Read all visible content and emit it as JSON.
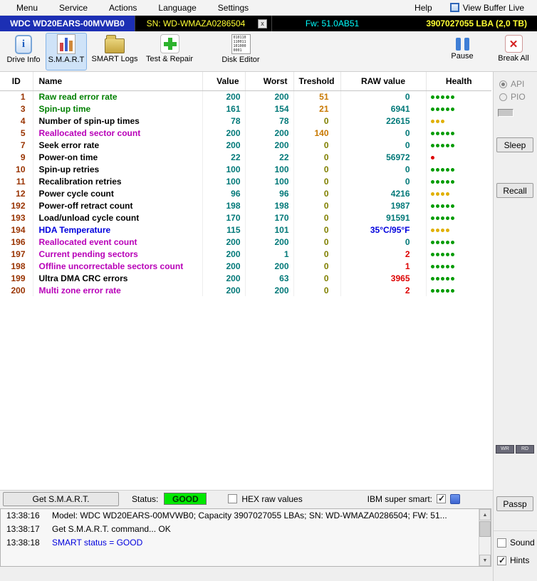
{
  "colors": {
    "green": "#008000",
    "magenta": "#b800b8",
    "blue": "#0000dd",
    "black": "#000000",
    "teal": "#007878",
    "orange": "#c87800",
    "olive": "#808000",
    "red": "#dd0000",
    "maroon": "#993300",
    "dot_green": "#009c00",
    "dot_yellow": "#e0b000",
    "dot_red": "#dd0000",
    "good_badge": "#00e800",
    "drive_tab_blue": "#1c2fb4",
    "title_yellow": "#ffff33",
    "title_cyan": "#00ffff"
  },
  "menubar": {
    "items": [
      {
        "label": "Menu"
      },
      {
        "label": "Service"
      },
      {
        "label": "Actions"
      },
      {
        "label": "Language"
      },
      {
        "label": "Settings"
      },
      {
        "label": "Help"
      }
    ],
    "view_buffer_label": "View Buffer Live"
  },
  "titlebar": {
    "model": "WDC WD20EARS-00MVWB0",
    "serial": "SN: WD-WMAZA0286504",
    "close_label": "x",
    "firmware": "Fw: 51.0AB51",
    "capacity": "3907027055 LBA (2,0 TB)"
  },
  "toolbar": {
    "buttons": [
      {
        "label": "Drive Info"
      },
      {
        "label": "S.M.A.R.T"
      },
      {
        "label": "SMART Logs"
      },
      {
        "label": "Test & Repair"
      },
      {
        "label": "Disk Editor"
      }
    ],
    "right_buttons": [
      {
        "label": "Pause"
      },
      {
        "label": "Break All"
      }
    ],
    "disk_editor_binary": "010110\n110011\n101000\n0001"
  },
  "table": {
    "headers": [
      "ID",
      "Name",
      "Value",
      "Worst",
      "Treshold",
      "RAW value",
      "Health"
    ],
    "rows": [
      {
        "id": "1",
        "name": "Raw read error rate",
        "name_color": "green",
        "value": "200",
        "worst": "200",
        "treshold": "51",
        "treshold_color": "orange",
        "raw": "0",
        "raw_color": "teal",
        "dots": 5,
        "dot_color": "dot_green"
      },
      {
        "id": "3",
        "name": "Spin-up time",
        "name_color": "green",
        "value": "161",
        "worst": "154",
        "treshold": "21",
        "treshold_color": "orange",
        "raw": "6941",
        "raw_color": "teal",
        "dots": 5,
        "dot_color": "dot_green"
      },
      {
        "id": "4",
        "name": "Number of spin-up times",
        "name_color": "black",
        "value": "78",
        "worst": "78",
        "treshold": "0",
        "treshold_color": "olive",
        "raw": "22615",
        "raw_color": "teal",
        "dots": 3,
        "dot_color": "dot_yellow"
      },
      {
        "id": "5",
        "name": "Reallocated sector count",
        "name_color": "magenta",
        "value": "200",
        "worst": "200",
        "treshold": "140",
        "treshold_color": "orange",
        "raw": "0",
        "raw_color": "teal",
        "dots": 5,
        "dot_color": "dot_green"
      },
      {
        "id": "7",
        "name": "Seek error rate",
        "name_color": "black",
        "value": "200",
        "worst": "200",
        "treshold": "0",
        "treshold_color": "olive",
        "raw": "0",
        "raw_color": "teal",
        "dots": 5,
        "dot_color": "dot_green"
      },
      {
        "id": "9",
        "name": "Power-on time",
        "name_color": "black",
        "value": "22",
        "worst": "22",
        "treshold": "0",
        "treshold_color": "olive",
        "raw": "56972",
        "raw_color": "teal",
        "dots": 1,
        "dot_color": "dot_red"
      },
      {
        "id": "10",
        "name": "Spin-up retries",
        "name_color": "black",
        "value": "100",
        "worst": "100",
        "treshold": "0",
        "treshold_color": "olive",
        "raw": "0",
        "raw_color": "teal",
        "dots": 5,
        "dot_color": "dot_green"
      },
      {
        "id": "11",
        "name": "Recalibration retries",
        "name_color": "black",
        "value": "100",
        "worst": "100",
        "treshold": "0",
        "treshold_color": "olive",
        "raw": "0",
        "raw_color": "teal",
        "dots": 5,
        "dot_color": "dot_green"
      },
      {
        "id": "12",
        "name": "Power cycle count",
        "name_color": "black",
        "value": "96",
        "worst": "96",
        "treshold": "0",
        "treshold_color": "olive",
        "raw": "4216",
        "raw_color": "teal",
        "dots": 4,
        "dot_color": "dot_yellow"
      },
      {
        "id": "192",
        "name": "Power-off retract count",
        "name_color": "black",
        "value": "198",
        "worst": "198",
        "treshold": "0",
        "treshold_color": "olive",
        "raw": "1987",
        "raw_color": "teal",
        "dots": 5,
        "dot_color": "dot_green"
      },
      {
        "id": "193",
        "name": "Load/unload cycle count",
        "name_color": "black",
        "value": "170",
        "worst": "170",
        "treshold": "0",
        "treshold_color": "olive",
        "raw": "91591",
        "raw_color": "teal",
        "dots": 5,
        "dot_color": "dot_green"
      },
      {
        "id": "194",
        "name": "HDA Temperature",
        "name_color": "blue",
        "value": "115",
        "worst": "101",
        "treshold": "0",
        "treshold_color": "olive",
        "raw": "35°C/95°F",
        "raw_color": "blue",
        "dots": 4,
        "dot_color": "dot_yellow"
      },
      {
        "id": "196",
        "name": "Reallocated event count",
        "name_color": "magenta",
        "value": "200",
        "worst": "200",
        "treshold": "0",
        "treshold_color": "olive",
        "raw": "0",
        "raw_color": "teal",
        "dots": 5,
        "dot_color": "dot_green"
      },
      {
        "id": "197",
        "name": "Current pending sectors",
        "name_color": "magenta",
        "value": "200",
        "worst": "1",
        "treshold": "0",
        "treshold_color": "olive",
        "raw": "2",
        "raw_color": "red",
        "dots": 5,
        "dot_color": "dot_green"
      },
      {
        "id": "198",
        "name": "Offline uncorrectable sectors count",
        "name_color": "magenta",
        "value": "200",
        "worst": "200",
        "treshold": "0",
        "treshold_color": "olive",
        "raw": "1",
        "raw_color": "red",
        "dots": 5,
        "dot_color": "dot_green"
      },
      {
        "id": "199",
        "name": "Ultra DMA CRC errors",
        "name_color": "black",
        "value": "200",
        "worst": "63",
        "treshold": "0",
        "treshold_color": "olive",
        "raw": "3965",
        "raw_color": "red",
        "dots": 5,
        "dot_color": "dot_green"
      },
      {
        "id": "200",
        "name": "Multi zone error rate",
        "name_color": "magenta",
        "value": "200",
        "worst": "200",
        "treshold": "0",
        "treshold_color": "olive",
        "raw": "2",
        "raw_color": "red",
        "dots": 5,
        "dot_color": "dot_green"
      }
    ]
  },
  "right_panel": {
    "radios": [
      {
        "label": "API",
        "selected": true
      },
      {
        "label": "PIO",
        "selected": false
      }
    ],
    "sleep_label": "Sleep",
    "recall_label": "Recall",
    "tiny_buttons": [
      "WR",
      "RD"
    ],
    "passp_label": "Passp"
  },
  "status_bar": {
    "get_smart_label": "Get S.M.A.R.T.",
    "status_label": "Status:",
    "status_value": "GOOD",
    "hex_label": "HEX raw values",
    "hex_checked": false,
    "ibm_label": "IBM super smart:",
    "ibm_checked": true
  },
  "log": {
    "lines": [
      {
        "time": "13:38:16",
        "text": "Model: WDC WD20EARS-00MVWB0; Capacity 3907027055 LBAs; SN: WD-WMAZA0286504; FW: 51...",
        "color": "black"
      },
      {
        "time": "13:38:17",
        "text": "Get S.M.A.R.T. command... OK",
        "color": "black"
      },
      {
        "time": "13:38:18",
        "text": "SMART status = GOOD",
        "color": "blue"
      }
    ],
    "sound_label": "Sound",
    "sound_checked": false,
    "hints_label": "Hints",
    "hints_checked": true
  }
}
